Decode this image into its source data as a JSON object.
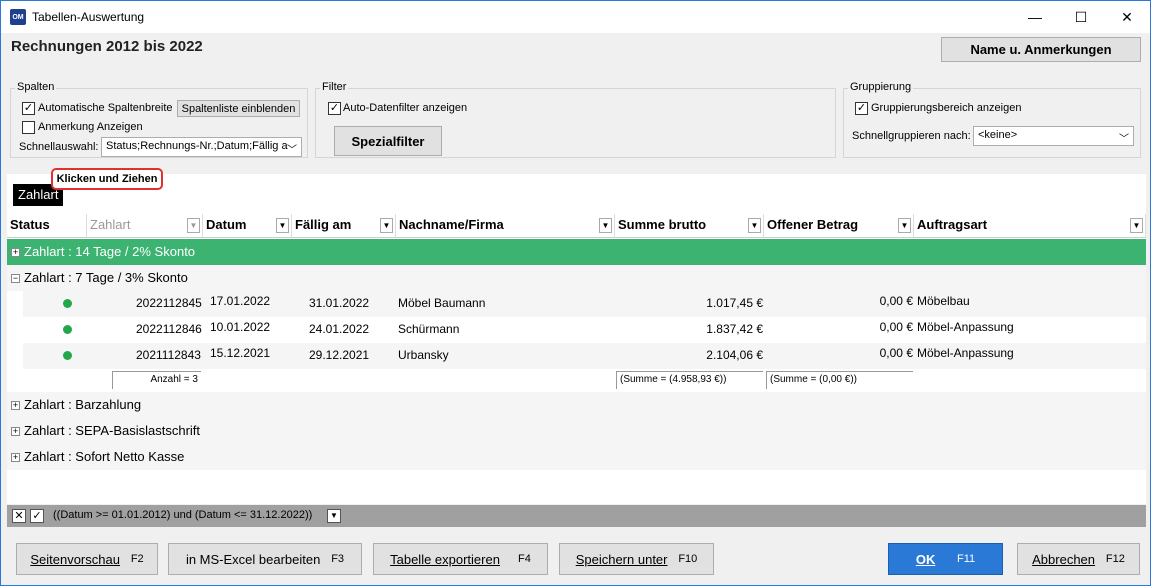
{
  "window": {
    "icon_text": "OM",
    "title": "Tabellen-Auswertung",
    "minimize": "—",
    "maximize": "☐",
    "close": "✕"
  },
  "heading": "Rechnungen 2012 bis 2022",
  "name_button": "Name u. Anmerkungen",
  "spalten": {
    "label": "Spalten",
    "auto_width": "Automatische Spaltenbreite",
    "auto_width_checked": true,
    "show_list_button": "Spaltenliste einblenden",
    "show_note": "Anmerkung Anzeigen",
    "show_note_checked": false,
    "quick_label": "Schnellauswahl:",
    "quick_value": "Status;Rechnungs-Nr.;Datum;Fällig a"
  },
  "filter": {
    "label": "Filter",
    "auto_filter": "Auto-Datenfilter anzeigen",
    "auto_filter_checked": true,
    "special_button": "Spezialfilter"
  },
  "gruppierung": {
    "label": "Gruppierung",
    "show_area": "Gruppierungsbereich anzeigen",
    "show_area_checked": true,
    "quick_label": "Schnellgruppieren nach:",
    "quick_value": "<keine>"
  },
  "group_chip": "Zahlart",
  "tooltip": "Klicken und Ziehen",
  "columns": [
    {
      "label": "Status"
    },
    {
      "label": "Zahlart"
    },
    {
      "label": "Datum"
    },
    {
      "label": "Fällig am"
    },
    {
      "label": "Nachname/Firma"
    },
    {
      "label": "Summe brutto"
    },
    {
      "label": "Offener Betrag"
    },
    {
      "label": "Auftragsart"
    }
  ],
  "groups": [
    {
      "label": "Zahlart : 14 Tage / 2% Skonto",
      "expanded": false,
      "selected": true
    },
    {
      "label": "Zahlart : 7 Tage / 3% Skonto",
      "expanded": true,
      "selected": false
    },
    {
      "label": "Zahlart : Barzahlung",
      "expanded": false
    },
    {
      "label": "Zahlart : SEPA-Basislastschrift",
      "expanded": false
    },
    {
      "label": "Zahlart : Sofort Netto Kasse",
      "expanded": false
    }
  ],
  "rows": [
    {
      "nr": "2022112845",
      "datum": "17.01.2022",
      "faellig": "31.01.2022",
      "name": "Möbel Baumann",
      "brutto": "1.017,45 €",
      "offen": "0,00 €",
      "art": "Möbelbau"
    },
    {
      "nr": "2022112846",
      "datum": "10.01.2022",
      "faellig": "24.01.2022",
      "name": "Schürmann",
      "brutto": "1.837,42 €",
      "offen": "0,00 €",
      "art": "Möbel-Anpassung"
    },
    {
      "nr": "2021112843",
      "datum": "15.12.2021",
      "faellig": "29.12.2021",
      "name": "Urbansky",
      "brutto": "2.104,06 €",
      "offen": "0,00 €",
      "art": "Möbel-Anpassung"
    }
  ],
  "summary": {
    "count": "Anzahl = 3",
    "sum_brutto": "(Summe =     (4.958,93 €))",
    "sum_offen": "(Summe =     (0,00 €))"
  },
  "filter_text": "((Datum >= 01.01.2012) und (Datum <= 31.12.2022))",
  "footer": {
    "preview": "Seitenvorschau",
    "preview_key": "F2",
    "excel": "in MS-Excel bearbeiten",
    "excel_key": "F3",
    "export": "Tabelle exportieren",
    "export_key": "F4",
    "save": "Speichern unter",
    "save_key": "F10",
    "ok": "OK",
    "ok_key": "F11",
    "cancel": "Abbrechen",
    "cancel_key": "F12"
  },
  "colors": {
    "accent": "#2b79d6",
    "selected_group": "#3cb371",
    "status_dot": "#22a84a",
    "filter_bar": "#a0a0a0"
  }
}
